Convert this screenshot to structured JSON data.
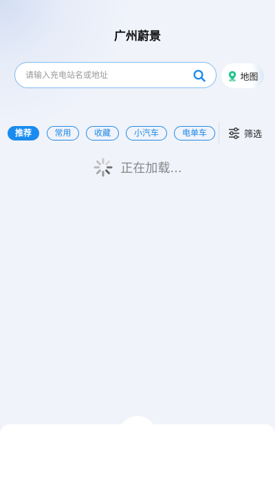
{
  "header": {
    "title": "广州蔚景"
  },
  "search": {
    "placeholder": "请输入充电站名或地址",
    "value": ""
  },
  "map_button": {
    "label": "地图"
  },
  "tabs": [
    {
      "label": "推荐",
      "active": true
    },
    {
      "label": "常用",
      "active": false
    },
    {
      "label": "收藏",
      "active": false
    },
    {
      "label": "小汽车",
      "active": false
    },
    {
      "label": "电单车",
      "active": false
    }
  ],
  "filter": {
    "label": "筛选"
  },
  "loading": {
    "text": "正在加载..."
  },
  "colors": {
    "accent": "#1a8cf0",
    "background": "#f0f3fa",
    "map_icon": "#22c58b"
  },
  "icons": {
    "search": "search-icon",
    "map": "map-pin-icon",
    "filter": "sliders-icon",
    "loading": "spinner-icon"
  }
}
